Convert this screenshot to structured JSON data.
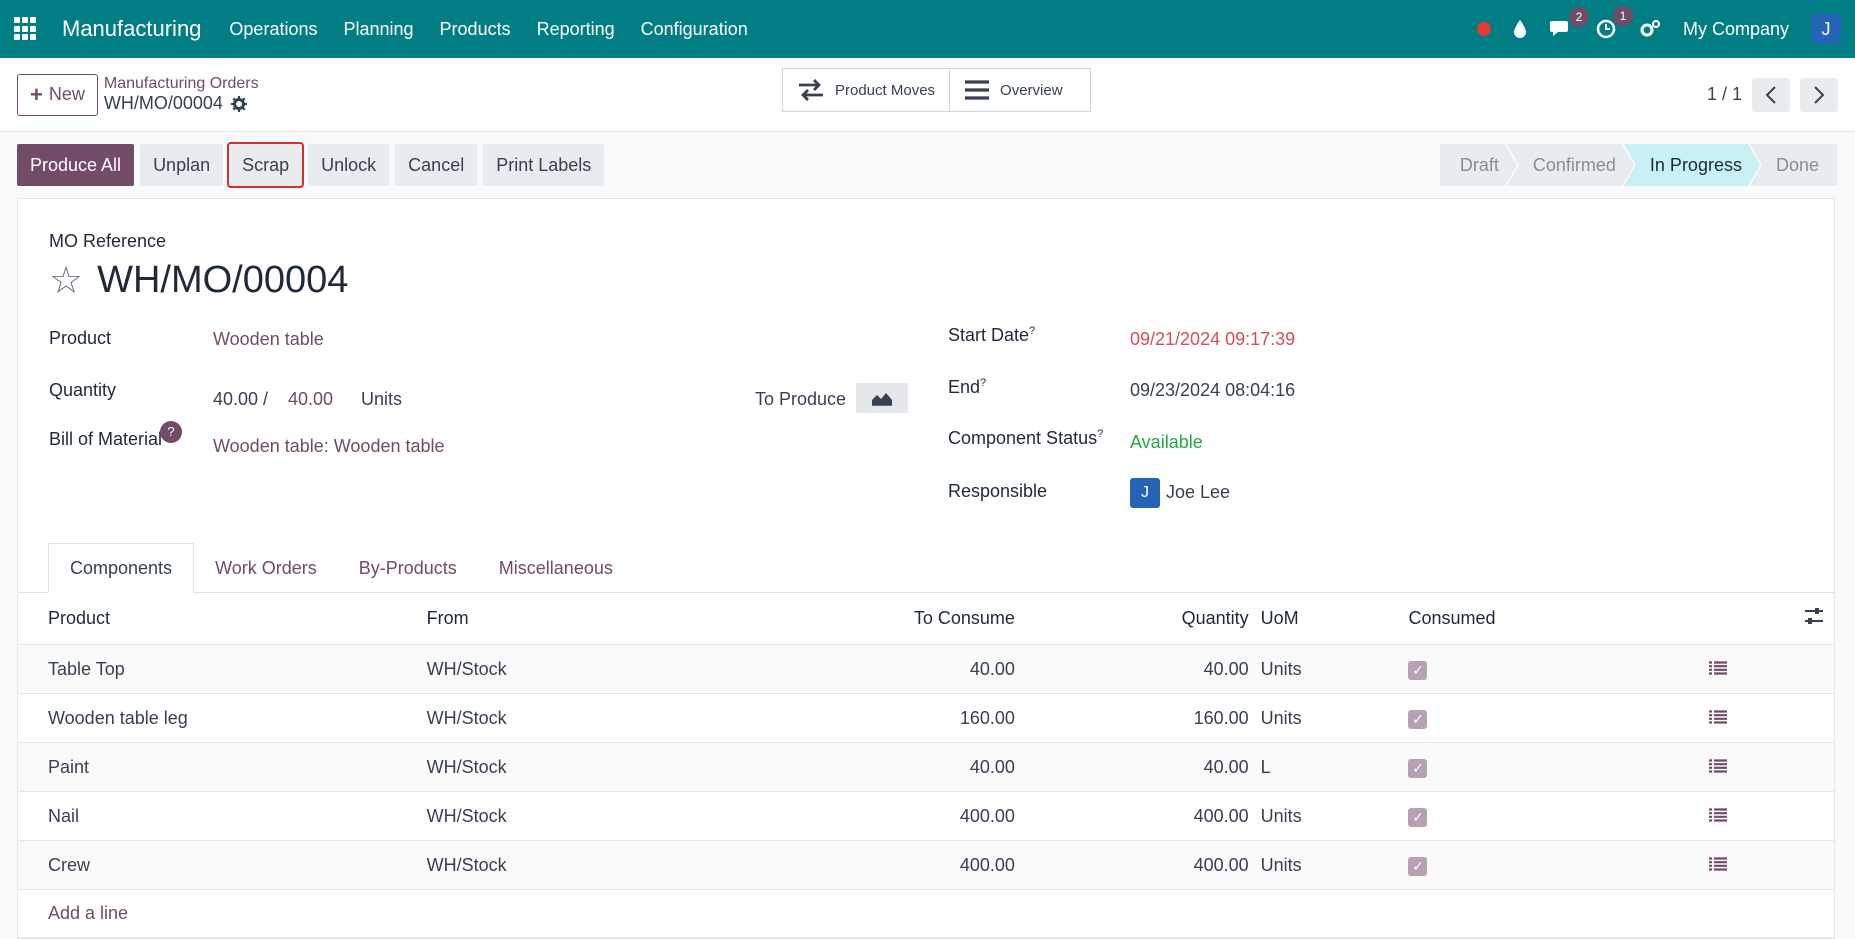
{
  "navbar": {
    "brand": "Manufacturing",
    "menu": [
      "Operations",
      "Planning",
      "Products",
      "Reporting",
      "Configuration"
    ],
    "messages_count": "2",
    "activities_count": "1",
    "company": "My Company",
    "user_initial": "J"
  },
  "control": {
    "new_label": "New",
    "breadcrumb_parent": "Manufacturing Orders",
    "breadcrumb_current": "WH/MO/00004",
    "smart_buttons": [
      "Product Moves",
      "Overview"
    ],
    "pager": "1 / 1"
  },
  "actions": [
    "Produce All",
    "Unplan",
    "Scrap",
    "Unlock",
    "Cancel",
    "Print Labels"
  ],
  "stages": [
    {
      "label": "Draft",
      "active": false
    },
    {
      "label": "Confirmed",
      "active": false
    },
    {
      "label": "In Progress",
      "active": true
    },
    {
      "label": "Done",
      "active": false
    }
  ],
  "form": {
    "mo_reference_label": "MO Reference",
    "mo_reference": "WH/MO/00004",
    "product_label": "Product",
    "product": "Wooden table",
    "quantity_label": "Quantity",
    "qty_produced": "40.00 /",
    "qty_to_produce": "40.00",
    "qty_uom": "Units",
    "to_produce_label": "To Produce",
    "bom_label": "Bill of Material",
    "bom_help": "?",
    "bom": "Wooden table: Wooden table",
    "start_date_label": "Start Date",
    "start_date": "09/21/2024 09:17:39",
    "end_label": "End",
    "end": "09/23/2024 08:04:16",
    "component_status_label": "Component Status",
    "component_status": "Available",
    "responsible_label": "Responsible",
    "responsible_initial": "J",
    "responsible": "Joe Lee",
    "help_mark": "?"
  },
  "tabs": [
    "Components",
    "Work Orders",
    "By-Products",
    "Miscellaneous"
  ],
  "table": {
    "headers": [
      "Product",
      "From",
      "To Consume",
      "Quantity",
      "UoM",
      "Consumed"
    ],
    "rows": [
      {
        "product": "Table Top",
        "from": "WH/Stock",
        "to_consume": "40.00",
        "quantity": "40.00",
        "uom": "Units"
      },
      {
        "product": "Wooden table leg",
        "from": "WH/Stock",
        "to_consume": "160.00",
        "quantity": "160.00",
        "uom": "Units"
      },
      {
        "product": "Paint",
        "from": "WH/Stock",
        "to_consume": "40.00",
        "quantity": "40.00",
        "uom": "L"
      },
      {
        "product": "Nail",
        "from": "WH/Stock",
        "to_consume": "400.00",
        "quantity": "400.00",
        "uom": "Units"
      },
      {
        "product": "Crew",
        "from": "WH/Stock",
        "to_consume": "400.00",
        "quantity": "400.00",
        "uom": "Units"
      }
    ],
    "add_line": "Add a line"
  },
  "icons": {
    "apps": "apps-grid-icon",
    "record": "record-dot-icon",
    "drop": "drop-icon",
    "chat": "chat-icon",
    "activity": "clock-icon",
    "settings": "gears-icon",
    "gear": "gear-icon",
    "star": "star-icon",
    "transfer": "transfer-arrows-icon",
    "list": "list-icon",
    "chart": "area-chart-icon",
    "optional_columns": "sliders-icon",
    "detail": "detail-list-icon"
  }
}
